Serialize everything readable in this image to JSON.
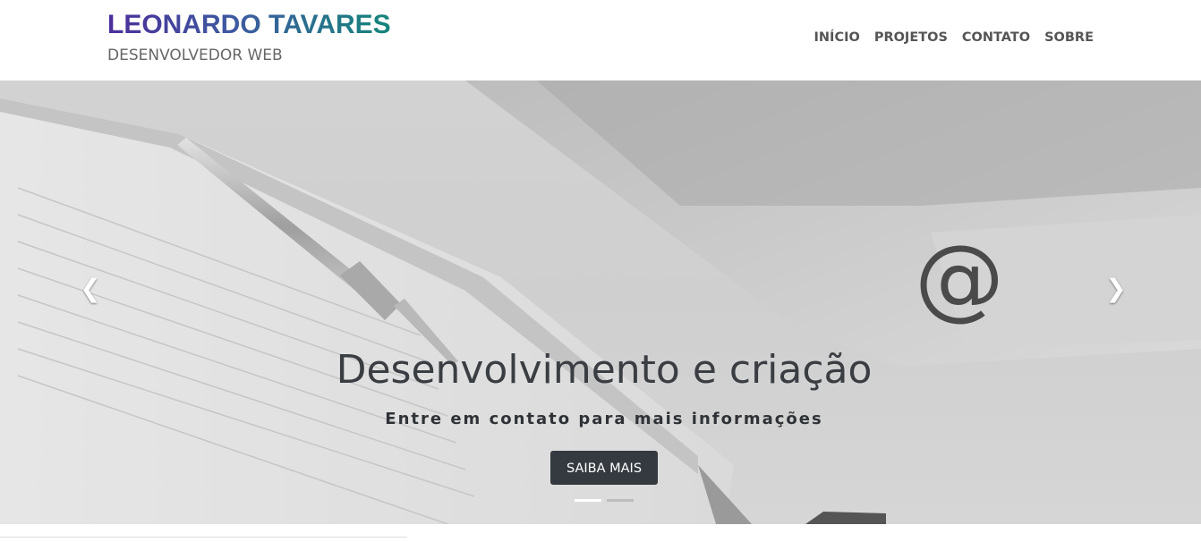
{
  "header": {
    "brand_name": "LEONARDO TAVARES",
    "brand_subtitle": "DESENVOLVEDOR WEB",
    "nav": [
      "INÍCIO",
      "PROJETOS",
      "CONTATO",
      "SOBRE"
    ]
  },
  "carousel": {
    "icon_text": "@",
    "title": "Desenvolvimento e criação",
    "subtitle": "Entre em contato para mais informações",
    "button_label": "SAIBA MAIS",
    "prev_icon": "chevron-left-icon",
    "next_icon": "chevron-right-icon",
    "slide_count": 2,
    "active_slide": 1
  },
  "colors": {
    "brand_gradient_start": "#4b2e9a",
    "brand_gradient_end": "#14867a",
    "button_bg": "#343a40",
    "indicator_active": "#ffffff",
    "indicator_inactive": "#bdbdbd"
  }
}
